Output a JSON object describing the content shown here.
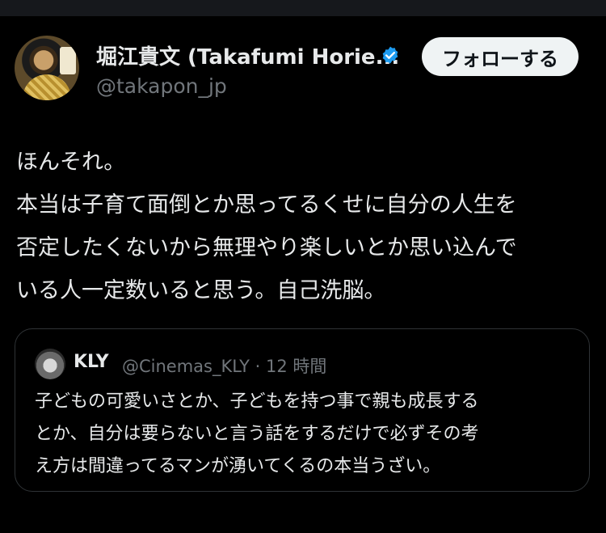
{
  "post": {
    "author_name": "堀江貴文 (Takafumi Horie...",
    "author_handle": "@takapon_jp",
    "follow_label": "フォローする",
    "lines": [
      "ほんそれ。",
      "本当は子育て面倒とか思ってるくせに自分の人生を",
      "否定したくないから無理やり楽しいとか思い込んで",
      "いる人一定数いると思う。自己洗脳。"
    ]
  },
  "quote": {
    "author_name": "KLY",
    "meta": "@Cinemas_KLY · 12 時間",
    "lines": [
      "子どもの可愛いさとか、子どもを持つ事で親も成長する",
      "とか、自分は要らないと言う話をするだけで必ずその考",
      "え方は間違ってるマンが湧いてくるの本当うざい。"
    ]
  },
  "colors": {
    "background": "#000000",
    "text": "#e7e9ea",
    "secondary": "#71767b",
    "verified": "#1d9bf0",
    "button_bg": "#eff3f4"
  },
  "icons": {
    "verified": "verified-badge-icon"
  }
}
